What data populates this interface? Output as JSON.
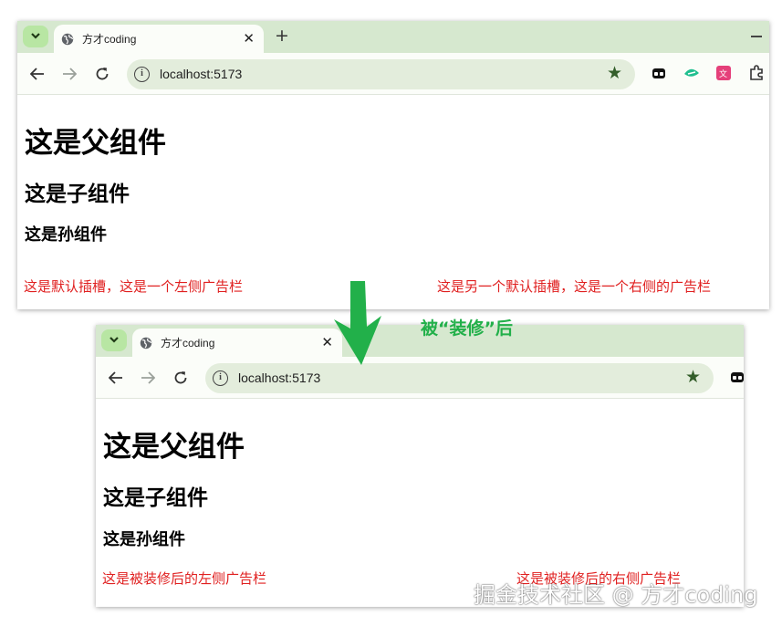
{
  "top_browser": {
    "tab_title": "方才coding",
    "url": "localhost:5173",
    "headings": {
      "parent": "这是父组件",
      "child": "这是子组件",
      "grandchild": "这是孙组件"
    },
    "ads": {
      "left": "这是默认插槽，这是一个左侧广告栏",
      "right": "这是另一个默认插槽，这是一个右侧的广告栏"
    }
  },
  "annotation": {
    "caption": "被“装修”后",
    "arrow_color": "#22b04a"
  },
  "bottom_browser": {
    "tab_title": "方才coding",
    "url": "localhost:5173",
    "headings": {
      "parent": "这是父组件",
      "child": "这是子组件",
      "grandchild": "这是孙组件"
    },
    "ads": {
      "left": "这是被装修后的左侧广告栏",
      "right": "这是被装修后的右侧广告栏"
    }
  },
  "watermark": "掘金技术社区 @ 方才coding",
  "colors": {
    "tabbar": "#d6e8cf",
    "ad_text": "#e02020",
    "bookmark_star": "#335e2a"
  },
  "icons": {
    "tab_search": "chevron-down-icon",
    "tab_favicon": "globe-icon",
    "tab_close": "close-icon",
    "new_tab": "plus-icon",
    "back": "arrow-left-icon",
    "forward": "arrow-right-icon",
    "reload": "reload-icon",
    "site_info": "info-icon",
    "bookmark": "star-icon",
    "extensions": "puzzle-icon"
  }
}
